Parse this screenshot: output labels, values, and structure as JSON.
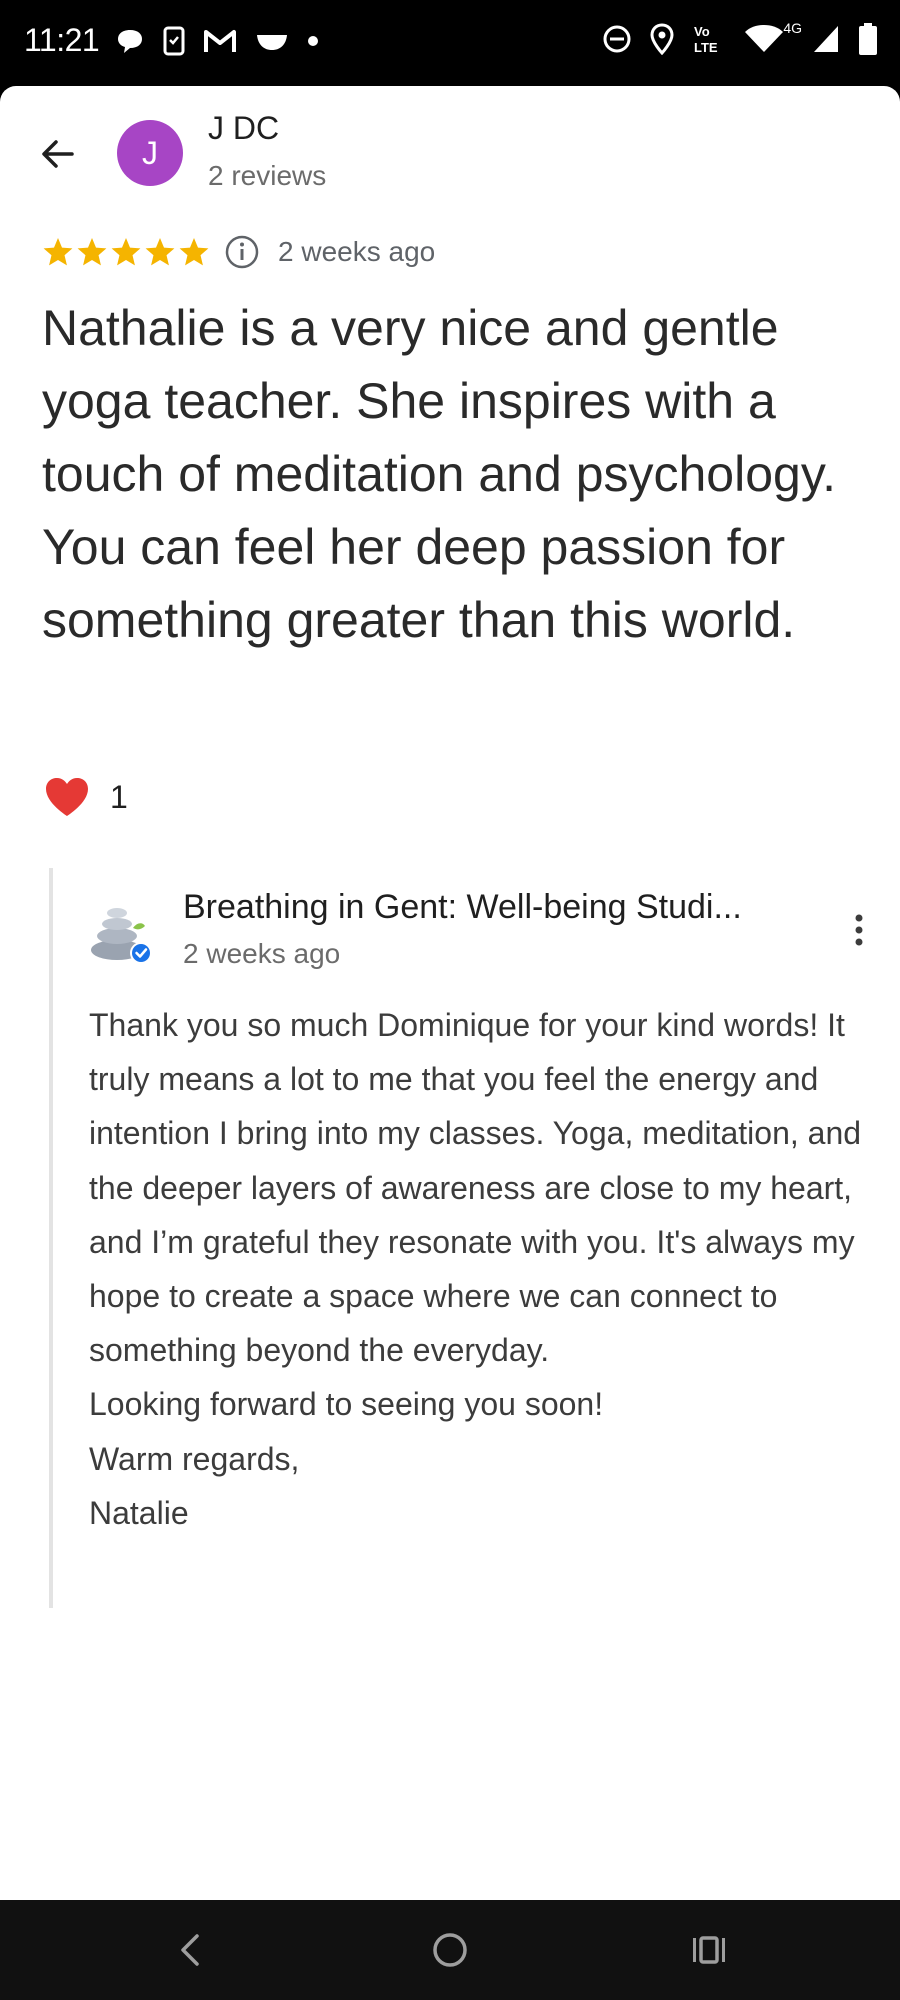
{
  "status_bar": {
    "time": "11:21",
    "left_icons": [
      "chat-bubble-icon",
      "phone-screen-icon",
      "gmail-icon",
      "bowl-icon",
      "dot-icon"
    ],
    "right_icons": [
      "do-not-disturb-icon",
      "location-pin-icon",
      "volte-icon",
      "wifi-icon",
      "cell-signal-icon",
      "battery-icon"
    ],
    "volte_label_top": "Vo",
    "volte_label_bottom": "LTE",
    "network_label": "4G"
  },
  "review": {
    "reviewer_initial": "J",
    "reviewer_name": "J DC",
    "reviewer_review_count": "2 reviews",
    "rating": 5,
    "date": "2 weeks ago",
    "text": "Nathalie is a very nice and gentle yoga teacher. She inspires with a touch of meditation and psychology. You can feel her deep passion for something greater than this world.",
    "reaction_count": "1"
  },
  "owner_reply": {
    "owner_name": "Breathing in Gent: Well-being Studi...",
    "date": "2 weeks ago",
    "paragraph_1": "Thank you so much Dominique for your kind words! It truly means a lot to me that you feel the energy and intention I bring into my classes. Yoga, meditation, and the deeper layers of awareness are close to my heart, and I’m grateful they resonate with you. It's always my hope to create a space where we can connect to something beyond the everyday.",
    "paragraph_2": "Looking forward to seeing you soon!",
    "paragraph_3": "Warm regards,",
    "paragraph_4": "Natalie"
  },
  "colors": {
    "avatar": "#a745c5",
    "star": "#f5b400",
    "heart": "#e53935",
    "verified": "#1a73e8"
  }
}
